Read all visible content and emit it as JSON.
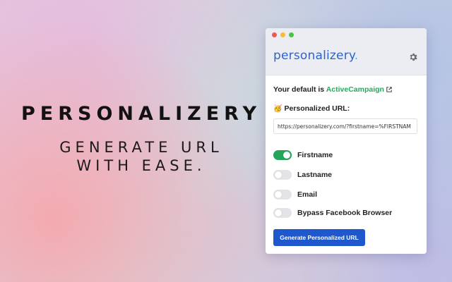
{
  "hero": {
    "title": "PERSONALIZERY",
    "subtitle_line1": "GENERATE URL",
    "subtitle_line2": "WITH EASE."
  },
  "popup": {
    "logo_text": "personalizery",
    "logo_dot": ".",
    "settings_icon": "gear-icon",
    "default_prefix": "Your default is ",
    "default_provider": "ActiveCampaign",
    "external_link_icon": "external-link-icon",
    "purl_emoji": "🥳",
    "purl_label": "Personalized URL:",
    "url_value": "https://personalizery.com/?firstname=%FIRSTNAM",
    "toggles": [
      {
        "label": "Firstname",
        "on": true
      },
      {
        "label": "Lastname",
        "on": false
      },
      {
        "label": "Email",
        "on": false
      },
      {
        "label": "Bypass Facebook Browser",
        "on": false
      }
    ],
    "generate_button": "Generate Personalized URL"
  },
  "colors": {
    "brand_blue": "#2a63d4",
    "accent_green": "#1fae5a",
    "toggle_on": "#23a55a",
    "button_bg": "#1f57cc"
  }
}
